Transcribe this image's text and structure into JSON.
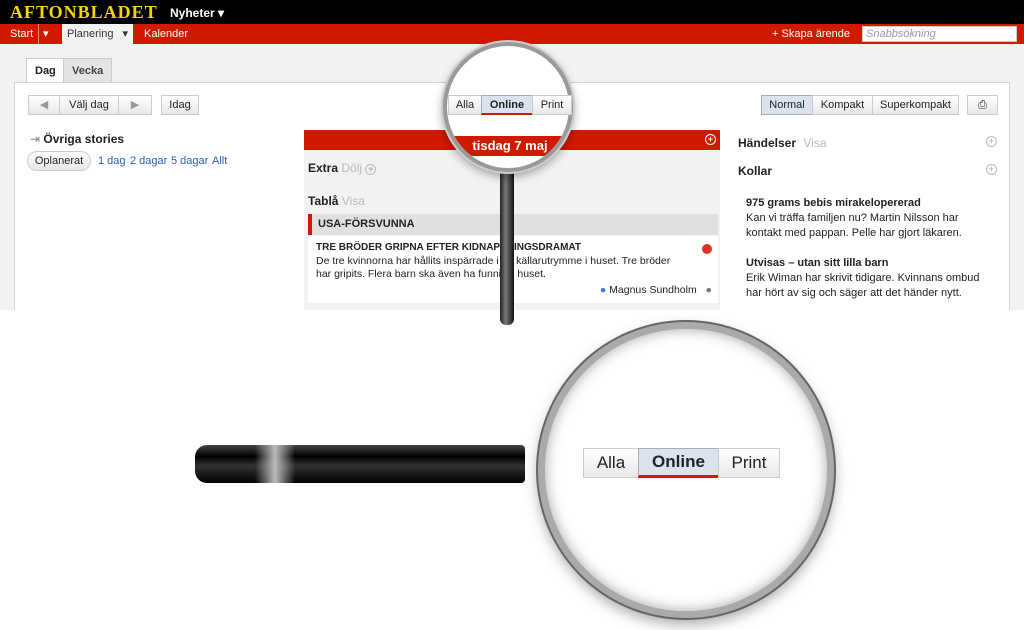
{
  "header": {
    "logo": "AFTONBLADET",
    "section": "Nyheter"
  },
  "nav": {
    "start": "Start",
    "planering": "Planering",
    "kalender": "Kalender",
    "create": "Skapa ärende",
    "search_placeholder": "Snabbsökning"
  },
  "tabs": [
    "Dag",
    "Vecka"
  ],
  "toolbar": {
    "choose_day": "Välj dag",
    "today": "Idag",
    "filter": [
      "Alla",
      "Online",
      "Print"
    ],
    "filter_selected": "Online",
    "density": [
      "Normal",
      "Kompakt",
      "Superkompakt"
    ],
    "density_selected": "Normal"
  },
  "left": {
    "title": "Övriga stories",
    "unplanned": "Oplanerat",
    "ranges": [
      "1 dag",
      "2 dagar",
      "5 dagar",
      "Allt"
    ]
  },
  "day": {
    "title": "tisdag 7 maj",
    "extra": "Extra",
    "extra_action": "Dölj",
    "tabla": "Tablå",
    "tabla_action": "Visa",
    "group": "USA-FÖRSVUNNA",
    "story": {
      "title": "TRE BRÖDER GRIPNA EFTER KIDNAPPNINGSDRAMAT",
      "body": "De tre kvinnorna har hållits inspärrade i ett källarutrymme i huset. Tre bröder har gripits. Flera barn ska även ha funnits i huset.",
      "author": "Magnus Sundholm",
      "status_color": "#e03020"
    }
  },
  "right": {
    "events": "Händelser",
    "events_action": "Visa",
    "checks": "Kollar",
    "items": [
      {
        "title": "975 grams bebis mirakelopererad",
        "body": "Kan vi träffa familjen nu? Martin Nilsson har kontakt med pappan. Pelle har gjort läkaren."
      },
      {
        "title": "Utvisas – utan sitt lilla barn",
        "body": "Erik Wiman har skrivit tidigare. Kvinnans ombud har hört av sig och säger att det händer nytt."
      }
    ]
  },
  "colors": {
    "brand_red": "#d01a00",
    "logo_yellow": "#f5d400"
  }
}
